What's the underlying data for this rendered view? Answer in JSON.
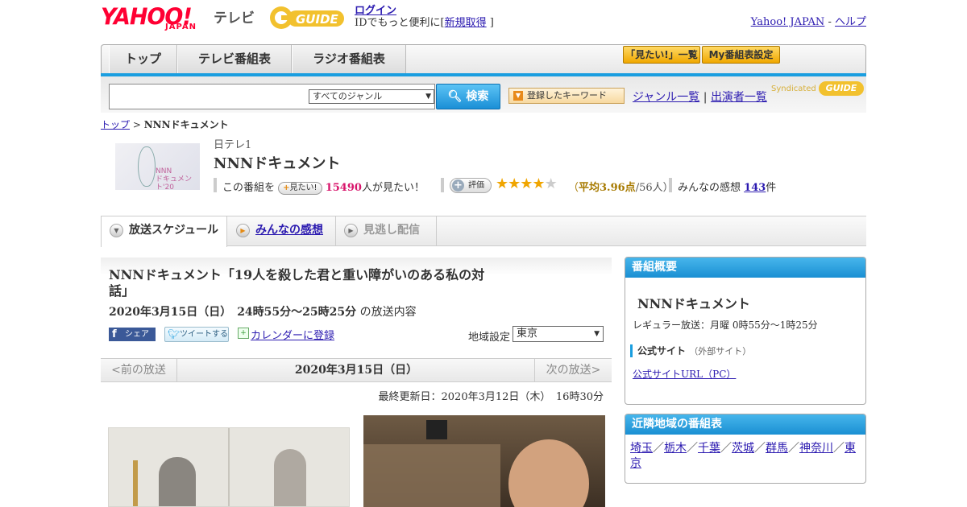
{
  "header": {
    "logo_yahoo": "YAHOO!",
    "logo_japan": "JAPAN",
    "logo_tv": "テレビ",
    "logo_guide": "GUIDE",
    "login_label": "ログイン",
    "login_desc": "IDでもっと便利に[",
    "signup_label": "新規取得",
    "login_desc_end": "]",
    "yahoo_japan_link": "Yahoo! JAPAN",
    "dash": "-",
    "help_link": "ヘルプ"
  },
  "nav": {
    "tabs": [
      "トップ",
      "テレビ番組表",
      "ラジオ番組表"
    ],
    "mitai_list": "「見たい!」一覧",
    "my_schedule": "My番組表設定"
  },
  "search": {
    "genre_selected": "すべてのジャンル",
    "search_button": "検索",
    "keyword_button": "登録したキーワード",
    "genre_list": "ジャンル一覧",
    "separator": "|",
    "cast_list": "出演者一覧",
    "syndicated": "Syndicated"
  },
  "breadcrumb": {
    "top": "トップ",
    "sep": " > ",
    "current": "NNNドキュメント"
  },
  "program": {
    "thumb_text_line1": "NNN",
    "thumb_text_line2": "ドキュメント'20",
    "channel": "日テレ1",
    "title": "NNNドキュメント",
    "mitai_prefix": "この番組を",
    "mitai_button": "見たい!",
    "mitai_count": "15490",
    "mitai_suffix": "人が見たい！",
    "rate_button": "評価",
    "rating_value": 3.96,
    "stars_total": 5,
    "avg_open": "（",
    "avg_label": "平均3.96点",
    "avg_count": "/56人）",
    "impressions_label": "みんなの感想",
    "impressions_count": "143",
    "impressions_unit": "件"
  },
  "content_tabs": [
    "放送スケジュール",
    "みんなの感想",
    "見逃し配信"
  ],
  "episode": {
    "title": "NNNドキュメント「19人を殺した君と重い障がいのある私の対話」",
    "date_bold": "2020年3月15日（日）　24時55分～25時25分",
    "date_suffix": "の放送内容",
    "fb_share": "シェア",
    "tweet": "ツイートする",
    "calendar": "カレンダーに登録",
    "area_label": "地域設定",
    "area_selected": "東京",
    "prev": "<前の放送",
    "current_date": "2020年3月15日（日）",
    "next": "次の放送>",
    "updated": "最終更新日：2020年3月12日（木）　16時30分"
  },
  "sidebar": {
    "overview_head": "番組概要",
    "overview_title": "NNNドキュメント",
    "regular": "レギュラー放送：月曜 0時55分～1時25分",
    "official_label": "公式サイト",
    "official_sub": "（外部サイト）",
    "official_url": "公式サイトURL（PC）",
    "nearby_head": "近隣地域の番組表",
    "nearby": [
      "埼玉",
      "栃木",
      "千葉",
      "茨城",
      "群馬",
      "神奈川",
      "東京"
    ],
    "nearby_sep": "／"
  },
  "colors": {
    "brand_red": "#ff0033",
    "accent_blue": "#1a9ee0",
    "star_gold": "#f0a500",
    "pink_count": "#d8166c"
  }
}
